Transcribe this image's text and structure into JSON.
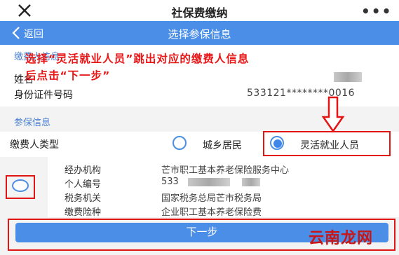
{
  "window": {
    "title": "社保费缴纳",
    "more_label": "•••"
  },
  "nav": {
    "back_label": "返回",
    "title": "选择参保信息"
  },
  "annotation": {
    "line1": "选择“灵活就业人员”跳出对应的缴费人信息",
    "line2": "后点击“下一步”"
  },
  "basic": {
    "section_label": "缴费人信息",
    "name_label": "姓名",
    "id_label": "身份证件号码",
    "id_value": "533121********0016"
  },
  "insured": {
    "section_label": "参保信息",
    "payer_type_label": "缴费人类型",
    "options": [
      "城乡居民",
      "灵活就业人员"
    ],
    "selected_option": "灵活就业人员"
  },
  "details": [
    {
      "label": "经办机构",
      "value": "芒市职工基本养老保险服务中心"
    },
    {
      "label": "个人编号",
      "value": "533"
    },
    {
      "label": "税务机关",
      "value": "国家税务总局芒市税务局"
    },
    {
      "label": "缴费险种",
      "value": "企业职工基本养老保险费"
    }
  ],
  "next_button": "下一步",
  "watermark": "云南龙网",
  "colors": {
    "accent": "#4b8ee8",
    "annotation": "#e81616"
  }
}
